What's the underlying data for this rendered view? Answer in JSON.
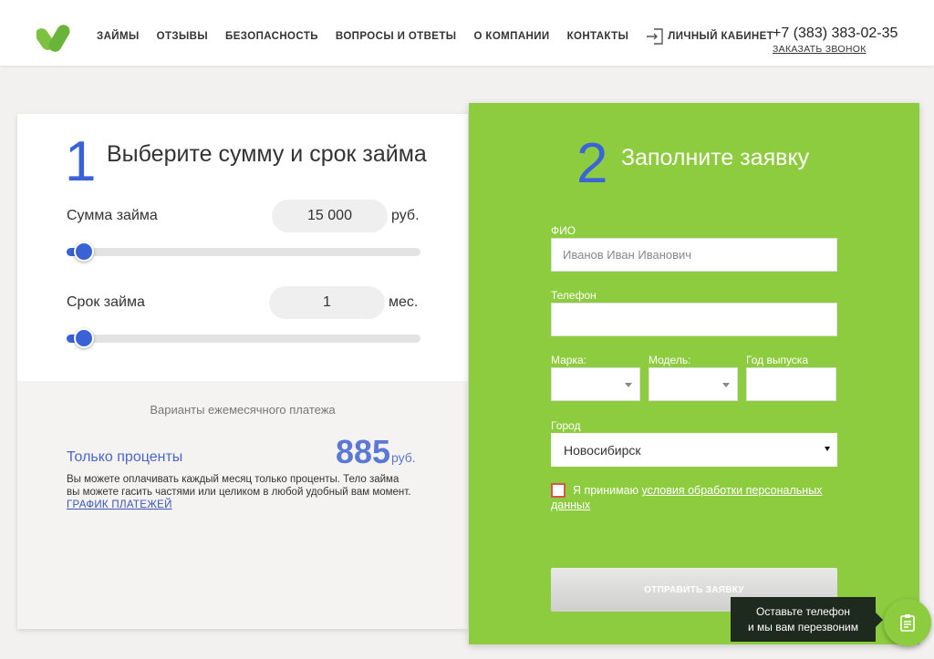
{
  "header": {
    "nav": [
      "ЗАЙМЫ",
      "ОТЗЫВЫ",
      "БЕЗОПАСНОСТЬ",
      "ВОПРОСЫ И ОТВЕТЫ",
      "О КОМПАНИИ",
      "КОНТАКТЫ"
    ],
    "cabinet_label": "ЛИЧНЫЙ КАБИНЕТ",
    "phone": "+7 (383) 383-02-35",
    "callback_label": "ЗАКАЗАТЬ ЗВОНОК",
    "logo_icon": "logo-v-icon",
    "cabinet_icon": "login-icon"
  },
  "calculator": {
    "step_number": "1",
    "title": "Выберите сумму и срок займа",
    "amount_label": "Сумма займа",
    "amount_value": "15 000",
    "amount_unit": "руб.",
    "amount_slider_fraction": 0.05,
    "term_label": "Срок займа",
    "term_value": "1",
    "term_unit": "мес.",
    "term_slider_fraction": 0.05,
    "variants_label": "Варианты ежемесячного платежа",
    "only_percent_label": "Только проценты",
    "payment_amount": "885",
    "payment_unit": "руб.",
    "description": "Вы можете оплачивать каждый месяц только проценты. Тело займа вы можете гасить частями или целиком в любой удобный вам момент.",
    "schedule_link": "ГРАФИК ПЛАТЕЖЕЙ"
  },
  "form": {
    "step_number": "2",
    "title": "Заполните заявку",
    "fio_label": "ФИО",
    "fio_placeholder": "Иванов Иван Иванович",
    "phone_label": "Телефон",
    "brand_label": "Марка:",
    "model_label": "Модель:",
    "year_label": "Год выпуска",
    "city_label": "Город",
    "city_value": "Новосибирск",
    "agree_text": "Я принимаю",
    "agree_link": "условия обработки персональных данных",
    "submit_label": "ОТПРАВИТЬ ЗАЯВКУ"
  },
  "callback_widget": {
    "tooltip_line1": "Оставьте телефон",
    "tooltip_line2": "и мы вам перезвоним",
    "icon": "clipboard-icon"
  },
  "colors": {
    "accent_blue": "#3862d6",
    "form_green": "#8dcc3f",
    "logo_green": "#7cc241"
  }
}
